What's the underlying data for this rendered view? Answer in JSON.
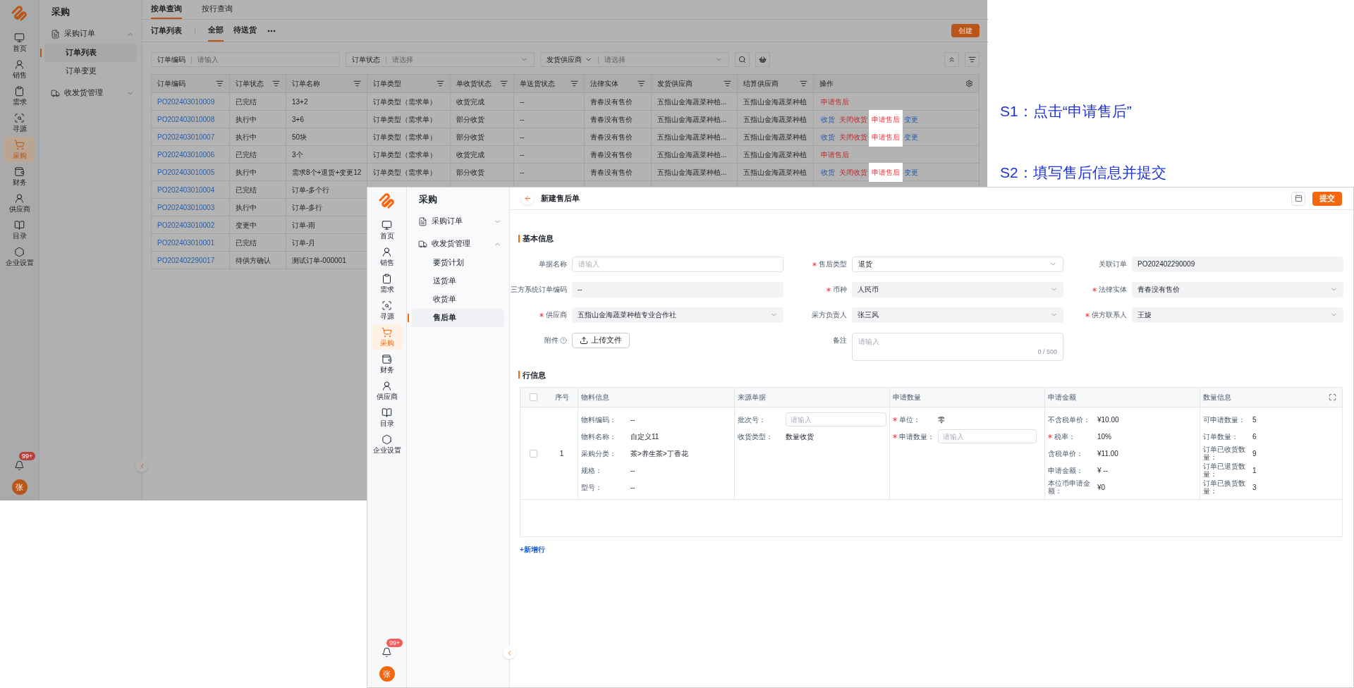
{
  "annotations": [
    {
      "text": "S1：点击“申请售后”"
    },
    {
      "text": "S2：填写售后信息并提交"
    }
  ],
  "order_list_screen": {
    "dimmed": true,
    "rail": {
      "items": [
        {
          "label": "首页",
          "selected": false
        },
        {
          "label": "销售",
          "selected": false
        },
        {
          "label": "需求",
          "selected": false
        },
        {
          "label": "寻源",
          "selected": false
        },
        {
          "label": "采购",
          "selected": true
        },
        {
          "label": "财务",
          "selected": false
        },
        {
          "label": "供应商",
          "selected": false
        },
        {
          "label": "目录",
          "selected": false
        },
        {
          "label": "企业设置",
          "selected": false
        }
      ],
      "notification_badge": "99+",
      "avatar": "张"
    },
    "nav": {
      "title": "采购",
      "groups": [
        {
          "label": "采购订单",
          "expanded": true,
          "children": [
            {
              "label": "订单列表",
              "selected": true
            },
            {
              "label": "订单变更",
              "selected": false
            }
          ]
        },
        {
          "label": "收发货管理",
          "expanded": false
        }
      ]
    },
    "tabs": [
      {
        "label": "按单查询",
        "selected": true
      },
      {
        "label": "按行查询",
        "selected": false
      }
    ],
    "list_title": "订单列表",
    "status_tabs": [
      {
        "label": "全部",
        "selected": true
      },
      {
        "label": "待送货",
        "selected": false
      }
    ],
    "create_button": "创建",
    "filters": [
      {
        "kind": "input",
        "label": "订单编码",
        "placeholder": "请输入"
      },
      {
        "kind": "select",
        "label": "订单状态",
        "placeholder": "请选择"
      },
      {
        "kind": "field-select",
        "label": "发货供应商",
        "placeholder": "请选择"
      }
    ],
    "table": {
      "columns": [
        "订单编码",
        "订单状态",
        "订单名称",
        "订单类型",
        "单收货状态",
        "单送货状态",
        "法律实体",
        "发货供应商",
        "结算供应商",
        "操作"
      ],
      "rows": [
        {
          "cells": [
            "PO202403010009",
            "已完结",
            "13+2",
            "订单类型（需求单）",
            "收货完成",
            "--",
            "青春没有售价",
            "五指山金海蔬菜种植...",
            "五指山金海蔬菜种植"
          ],
          "actions": [
            {
              "label": "申请售后",
              "kind": "danger",
              "highlighted": false
            }
          ]
        },
        {
          "cells": [
            "PO202403010008",
            "执行中",
            "3+6",
            "订单类型（需求单）",
            "部分收货",
            "--",
            "青春没有售价",
            "五指山金海蔬菜种植...",
            "五指山金海蔬菜种植"
          ],
          "actions": [
            {
              "label": "收货",
              "kind": "link",
              "highlighted": false
            },
            {
              "label": "关闭收货",
              "kind": "danger",
              "highlighted": false
            },
            {
              "label": "申请售后",
              "kind": "danger",
              "highlighted": true
            },
            {
              "label": "变更",
              "kind": "link",
              "highlighted": false
            }
          ]
        },
        {
          "cells": [
            "PO202403010007",
            "执行中",
            "50块",
            "订单类型（需求单）",
            "部分收货",
            "--",
            "青春没有售价",
            "五指山金海蔬菜种植...",
            "五指山金海蔬菜种植"
          ],
          "actions": [
            {
              "label": "收货",
              "kind": "link",
              "highlighted": false
            },
            {
              "label": "关闭收货",
              "kind": "danger",
              "highlighted": false
            },
            {
              "label": "申请售后",
              "kind": "danger",
              "highlighted": true
            },
            {
              "label": "变更",
              "kind": "link",
              "highlighted": false
            }
          ]
        },
        {
          "cells": [
            "PO202403010006",
            "已完结",
            "3个",
            "订单类型（需求单）",
            "收货完成",
            "--",
            "青春没有售价",
            "五指山金海蔬菜种植...",
            "五指山金海蔬菜种植"
          ],
          "actions": [
            {
              "label": "申请售后",
              "kind": "danger",
              "highlighted": false
            }
          ]
        },
        {
          "cells": [
            "PO202403010005",
            "执行中",
            "需求8个+退货+变更12",
            "订单类型（需求单）",
            "部分收货",
            "--",
            "青春没有售价",
            "五指山金海蔬菜种植...",
            "五指山金海蔬菜种植"
          ],
          "actions": [
            {
              "label": "收货",
              "kind": "link",
              "highlighted": false
            },
            {
              "label": "关闭收货",
              "kind": "danger",
              "highlighted": false
            },
            {
              "label": "申请售后",
              "kind": "danger",
              "highlighted": true
            },
            {
              "label": "变更",
              "kind": "link",
              "highlighted": false
            }
          ]
        },
        {
          "cells": [
            "PO202403010004",
            "已完结",
            "订单-多个行"
          ]
        },
        {
          "cells": [
            "PO202403010003",
            "执行中",
            "订单-多行"
          ]
        },
        {
          "cells": [
            "PO202403010002",
            "变更中",
            "订单-雨"
          ]
        },
        {
          "cells": [
            "PO202403010001",
            "已完结",
            "订单-月"
          ]
        },
        {
          "cells": [
            "PO202402290017",
            "待供方确认",
            "测试订单-000001"
          ]
        }
      ]
    }
  },
  "after_sales_form_screen": {
    "dimmed": false,
    "rail": {
      "items": [
        {
          "label": "首页",
          "selected": false
        },
        {
          "label": "销售",
          "selected": false
        },
        {
          "label": "需求",
          "selected": false
        },
        {
          "label": "寻源",
          "selected": false
        },
        {
          "label": "采购",
          "selected": true
        },
        {
          "label": "财务",
          "selected": false
        },
        {
          "label": "供应商",
          "selected": false
        },
        {
          "label": "目录",
          "selected": false
        },
        {
          "label": "企业设置",
          "selected": false
        }
      ],
      "notification_badge": "99+",
      "avatar": "张"
    },
    "nav": {
      "title": "采购",
      "groups": [
        {
          "label": "采购订单",
          "expanded": false
        },
        {
          "label": "收发货管理",
          "expanded": true,
          "children": [
            {
              "label": "要货计划",
              "selected": false
            },
            {
              "label": "送货单",
              "selected": false
            },
            {
              "label": "收货单",
              "selected": false
            },
            {
              "label": "售后单",
              "selected": true
            }
          ]
        }
      ]
    },
    "header": {
      "title": "新建售后单",
      "submit_button": "提交"
    },
    "basic_info": {
      "title": "基本信息",
      "fields": [
        {
          "kind": "input",
          "label": "单据名称",
          "required": false,
          "placeholder": "请输入"
        },
        {
          "kind": "select",
          "label": "售后类型",
          "required": true,
          "value": "退货"
        },
        {
          "kind": "readonly",
          "label": "关联订单",
          "required": false,
          "value": "PO202402290009"
        },
        {
          "kind": "readonly",
          "label": "三方系统订单编码",
          "required": false,
          "value": "--"
        },
        {
          "kind": "select-filled",
          "label": "币种",
          "required": true,
          "value": "人民币"
        },
        {
          "kind": "select-filled",
          "label": "法律实体",
          "required": true,
          "value": "青春没有售价"
        },
        {
          "kind": "select-filled",
          "label": "供应商",
          "required": true,
          "value": "五指山金海蔬菜种植专业合作社"
        },
        {
          "kind": "select-filled",
          "label": "采方负责人",
          "required": false,
          "value": "张三风"
        },
        {
          "kind": "select-filled",
          "label": "供方联系人",
          "required": true,
          "value": "王旋"
        },
        {
          "kind": "upload",
          "label": "附件",
          "required": false,
          "button": "上传文件"
        },
        {
          "kind": "textarea",
          "label": "备注",
          "required": false,
          "placeholder": "请输入",
          "counter": "0 / 500"
        }
      ]
    },
    "line_info": {
      "title": "行信息",
      "all_checked": false,
      "columns": [
        "序号",
        "物料信息",
        "来源单据",
        "申请数量",
        "申请金额",
        "数量信息"
      ],
      "rows": [
        {
          "checked": false,
          "index": "1",
          "groups": [
            [
              {
                "kind": "text",
                "label": "物料编码：",
                "required": false,
                "value": "--"
              },
              {
                "kind": "text",
                "label": "物料名称：",
                "required": false,
                "value": "自定义11"
              },
              {
                "kind": "text",
                "label": "采购分类：",
                "required": false,
                "value": "茶>养生茶>丁香花"
              },
              {
                "kind": "text",
                "label": "规格：",
                "required": false,
                "value": "--"
              },
              {
                "kind": "text",
                "label": "型号：",
                "required": false,
                "value": "--"
              }
            ],
            [
              {
                "kind": "input",
                "label": "批次号：",
                "required": false,
                "placeholder": "请输入"
              },
              {
                "kind": "text",
                "label": "收货类型：",
                "required": false,
                "value": "数量收货"
              }
            ],
            [
              {
                "kind": "text",
                "label": "单位：",
                "required": true,
                "value": "零"
              },
              {
                "kind": "input",
                "label": "申请数量：",
                "required": true,
                "placeholder": "请输入"
              }
            ],
            [
              {
                "kind": "text",
                "label": "不含税单价：",
                "required": false,
                "value": "¥10.00"
              },
              {
                "kind": "text",
                "label": "税率：",
                "required": true,
                "value": "10%"
              },
              {
                "kind": "text",
                "label": "含税单价：",
                "required": false,
                "value": "¥11.00"
              },
              {
                "kind": "text",
                "label": "申请金额：",
                "required": false,
                "value": "¥ --"
              },
              {
                "kind": "text",
                "label": "本位币申请金额：",
                "required": false,
                "value": "¥0"
              }
            ],
            [
              {
                "kind": "text",
                "label": "可申请数量：",
                "required": false,
                "value": "5"
              },
              {
                "kind": "text",
                "label": "订单数量：",
                "required": false,
                "value": "6"
              },
              {
                "kind": "text",
                "label": "订单已收货数量：",
                "required": false,
                "value": "9"
              },
              {
                "kind": "text",
                "label": "订单已退货数量：",
                "required": false,
                "value": "1"
              },
              {
                "kind": "text",
                "label": "订单已换货数量：",
                "required": false,
                "value": "3"
              }
            ]
          ]
        }
      ],
      "add_row": "+新增行"
    }
  }
}
